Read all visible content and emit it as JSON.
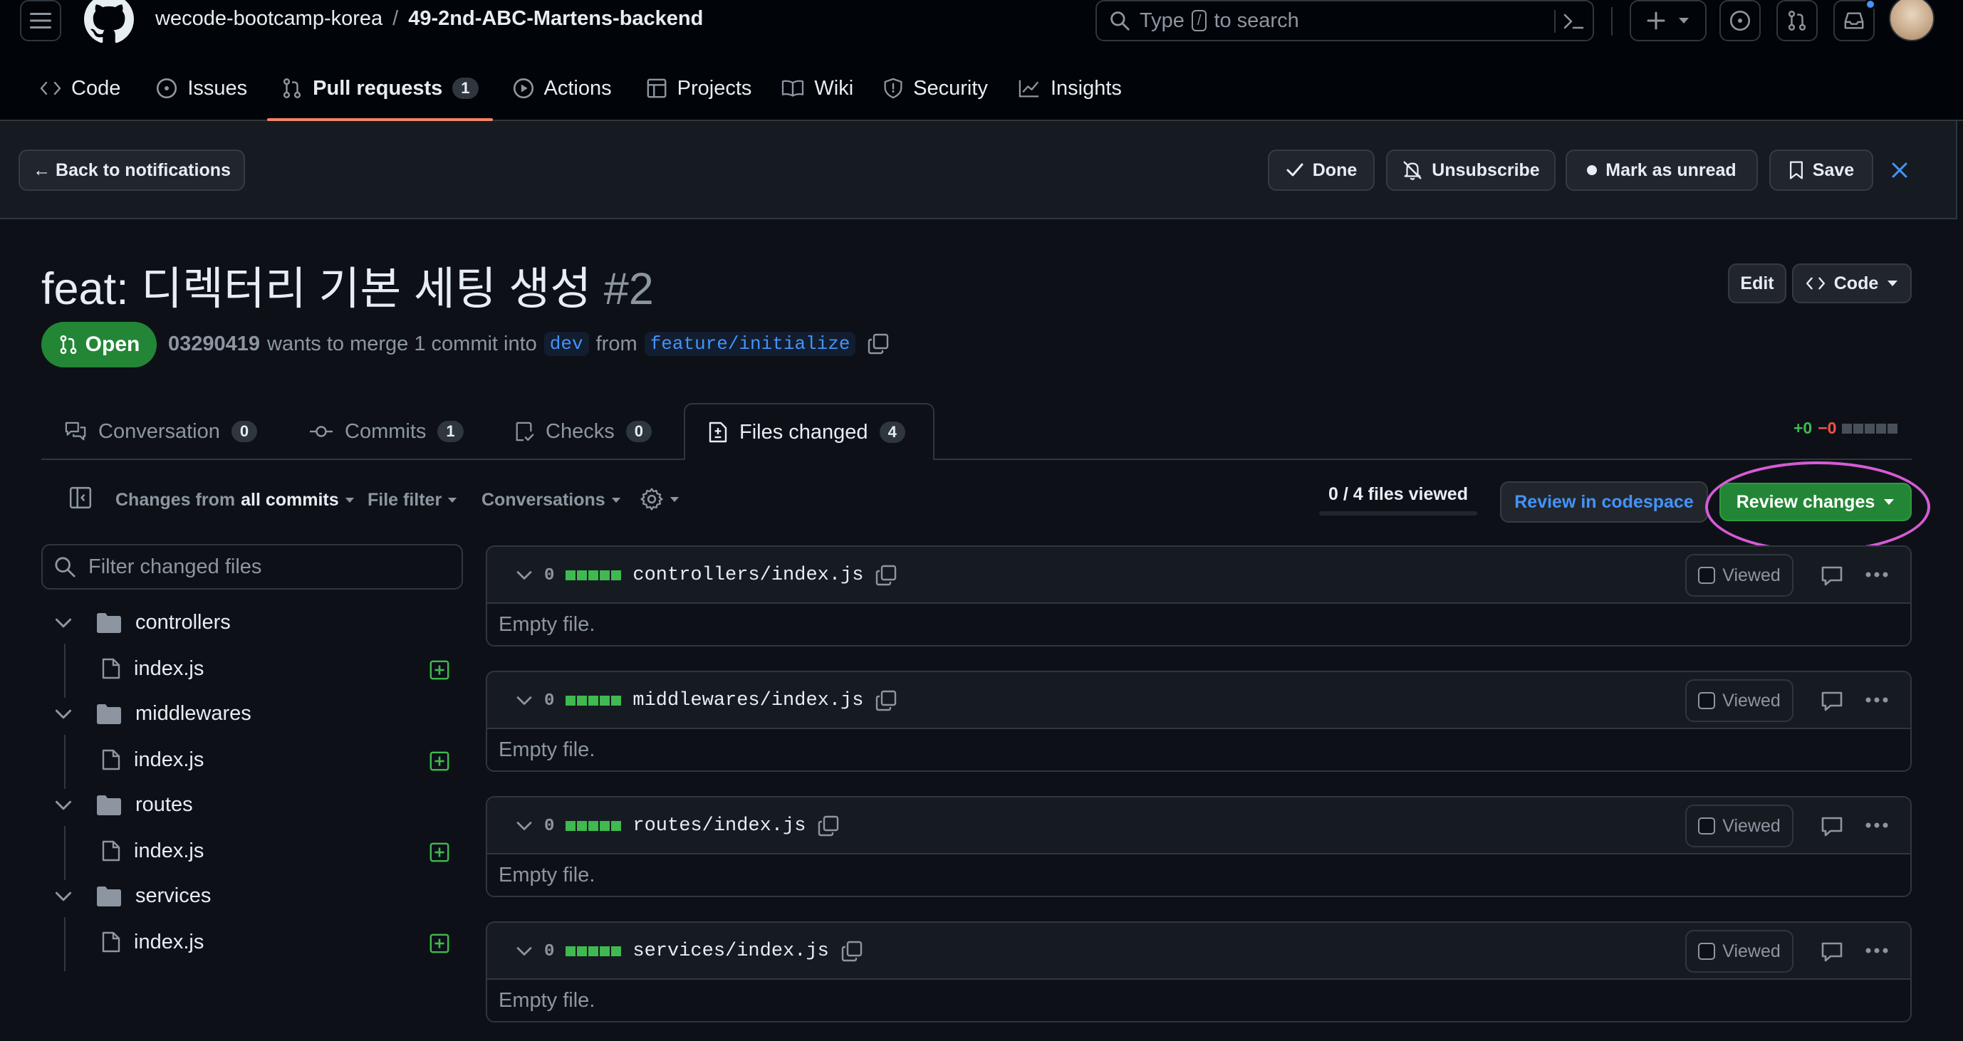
{
  "header": {
    "owner": "wecode-bootcamp-korea",
    "separator": "/",
    "repo": "49-2nd-ABC-Martens-backend",
    "search_before": "Type",
    "search_key": "/",
    "search_after": "to search"
  },
  "nav": {
    "code": "Code",
    "issues": "Issues",
    "pulls": "Pull requests",
    "pulls_count": "1",
    "actions": "Actions",
    "projects": "Projects",
    "wiki": "Wiki",
    "security": "Security",
    "insights": "Insights"
  },
  "notification": {
    "back": "← Back to notifications",
    "done": "Done",
    "unsubscribe": "Unsubscribe",
    "mark_unread": "Mark as unread",
    "save": "Save"
  },
  "pr": {
    "title": "feat: 디렉터리 기본 세팅 생성",
    "number": "#2",
    "edit": "Edit",
    "code_button": "Code",
    "state": "Open",
    "author": "03290419",
    "merge_text": "wants to merge 1 commit into",
    "base_branch": "dev",
    "from_text": "from",
    "head_branch": "feature/initialize"
  },
  "tabs": {
    "conversation": "Conversation",
    "conversation_count": "0",
    "commits": "Commits",
    "commits_count": "1",
    "checks": "Checks",
    "checks_count": "0",
    "files": "Files changed",
    "files_count": "4",
    "additions": "+0",
    "deletions": "−0"
  },
  "toolbar": {
    "changes_prefix": "Changes from",
    "changes_value": "all commits",
    "file_filter": "File filter",
    "conversations": "Conversations",
    "files_viewed": "0 / 4 files viewed",
    "review_codespace": "Review in codespace",
    "review_changes": "Review changes"
  },
  "tree": {
    "filter_placeholder": "Filter changed files",
    "folders": [
      {
        "name": "controllers",
        "file": "index.js"
      },
      {
        "name": "middlewares",
        "file": "index.js"
      },
      {
        "name": "routes",
        "file": "index.js"
      },
      {
        "name": "services",
        "file": "index.js"
      }
    ]
  },
  "files": [
    {
      "count": "0",
      "path": "controllers/index.js",
      "viewed_label": "Viewed",
      "body": "Empty file."
    },
    {
      "count": "0",
      "path": "middlewares/index.js",
      "viewed_label": "Viewed",
      "body": "Empty file."
    },
    {
      "count": "0",
      "path": "routes/index.js",
      "viewed_label": "Viewed",
      "body": "Empty file."
    },
    {
      "count": "0",
      "path": "services/index.js",
      "viewed_label": "Viewed",
      "body": "Empty file."
    }
  ],
  "colors": {
    "open_green": "#238636",
    "primary_button": "#238636",
    "tab_underline": "#f78166",
    "annotation_circle": "#d65bd6",
    "link_blue": "#4493f8"
  }
}
